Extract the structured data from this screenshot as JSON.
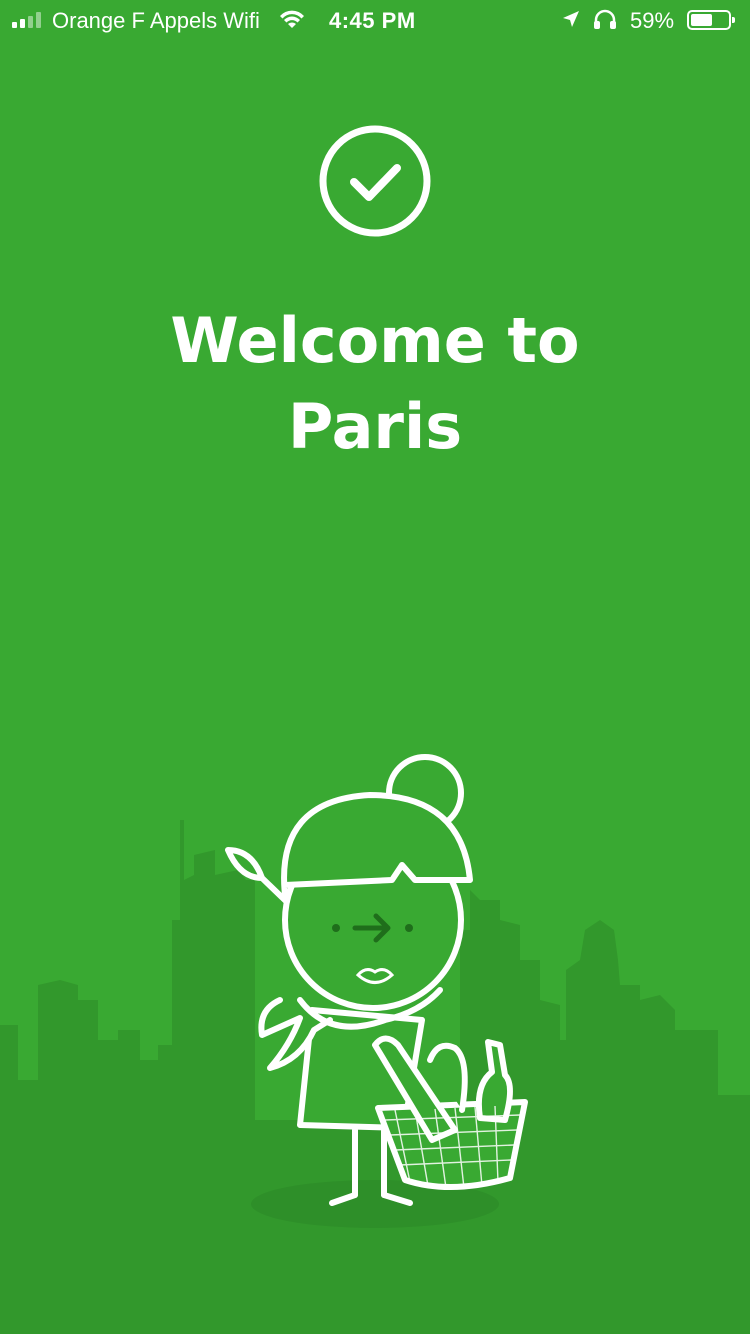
{
  "status_bar": {
    "carrier": "Orange F Appels Wifi",
    "time": "4:45 PM",
    "battery_percent": "59%",
    "battery_level": 0.59,
    "signal_bars": 2,
    "icons": [
      "cellular-signal-icon",
      "wifi-icon",
      "location-arrow-icon",
      "headphones-icon",
      "battery-icon"
    ]
  },
  "main": {
    "badge_icon": "checkmark-circle-icon",
    "title_line1": "Welcome to",
    "title_line2": "Paris",
    "illustration": "parisian-woman-with-basket-illustration"
  },
  "colors": {
    "background": "#39a932",
    "skyline": "#32982c",
    "foreground": "#ffffff",
    "face_detail": "#1f6e1b"
  }
}
